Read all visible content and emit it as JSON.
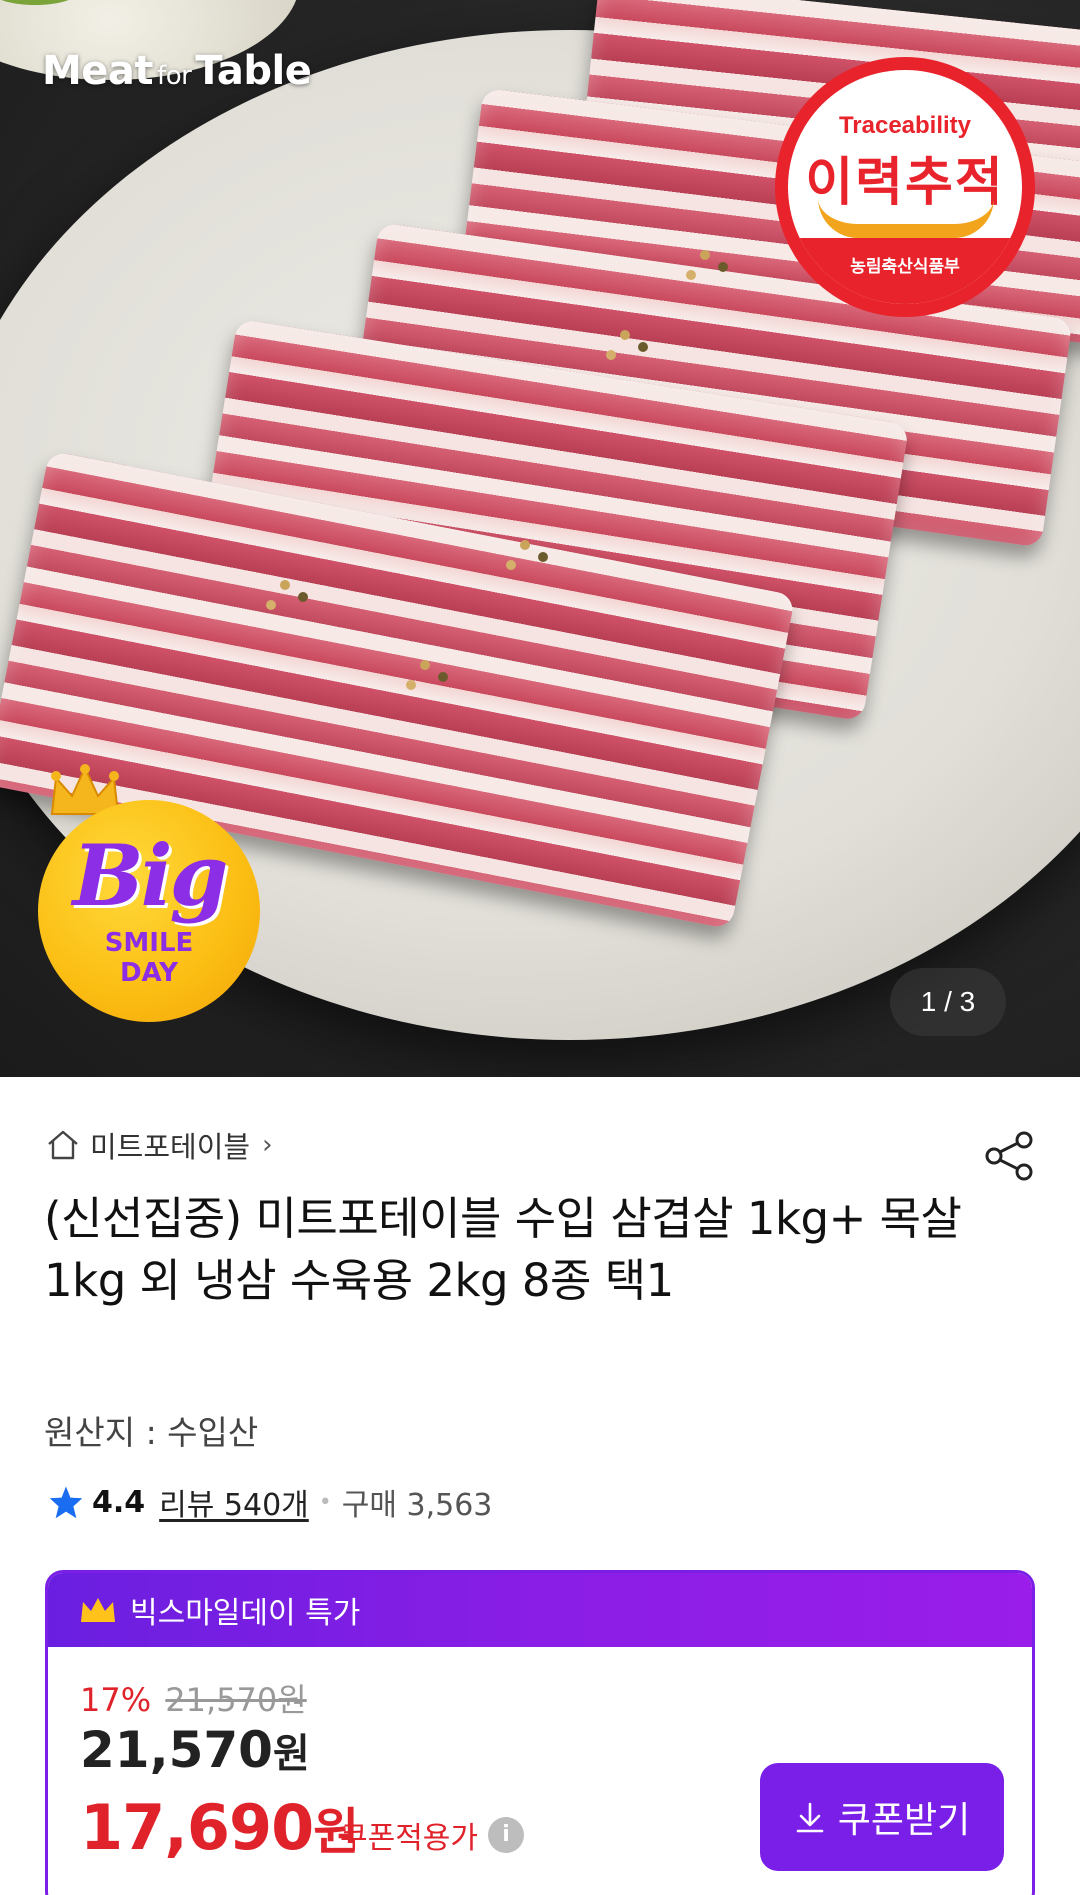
{
  "hero": {
    "brand_logo_main": "Meat",
    "brand_logo_small": "for",
    "brand_logo_end": "Table",
    "trace_badge_en": "Traceability",
    "trace_badge_ko": "이력추적",
    "trace_badge_org": "농림축산식품부",
    "promo_badge_big": "Big",
    "promo_badge_line1": "SMILE",
    "promo_badge_line2": "DAY",
    "page_indicator": "1 / 3",
    "current_image": 1,
    "total_images": 3
  },
  "store": {
    "name": "미트포테이블",
    "chevron": "›"
  },
  "product": {
    "title": "(신선집중) 미트포테이블 수입 삼겹살 1kg+ 목살 1kg 외 냉삼 수육용 2kg 8종 택1",
    "origin": "원산지 : 수입산"
  },
  "rating": {
    "score": "4.4",
    "reviews": "리뷰 540개",
    "separator": "•",
    "sales": "구매 3,563"
  },
  "price_card": {
    "deal_label": "빅스마일데이 특가",
    "discount_rate": "17%",
    "original_price": "21,570원",
    "sale_price_number": "21,570",
    "sale_price_unit": "원",
    "coupon_price_number": "17,690",
    "coupon_price_unit": "원",
    "coupon_label": "쿠폰적용가",
    "info_symbol": "i",
    "coupon_button": "쿠폰받기"
  },
  "colors": {
    "accent_purple": "#7a1fe8",
    "price_red": "#e0232b",
    "star_blue": "#1a6cf0",
    "trace_red": "#e8232b"
  },
  "icons": [
    "home-icon",
    "chevron-right-icon",
    "share-icon",
    "star-icon",
    "crown-icon",
    "info-icon",
    "download-icon"
  ]
}
